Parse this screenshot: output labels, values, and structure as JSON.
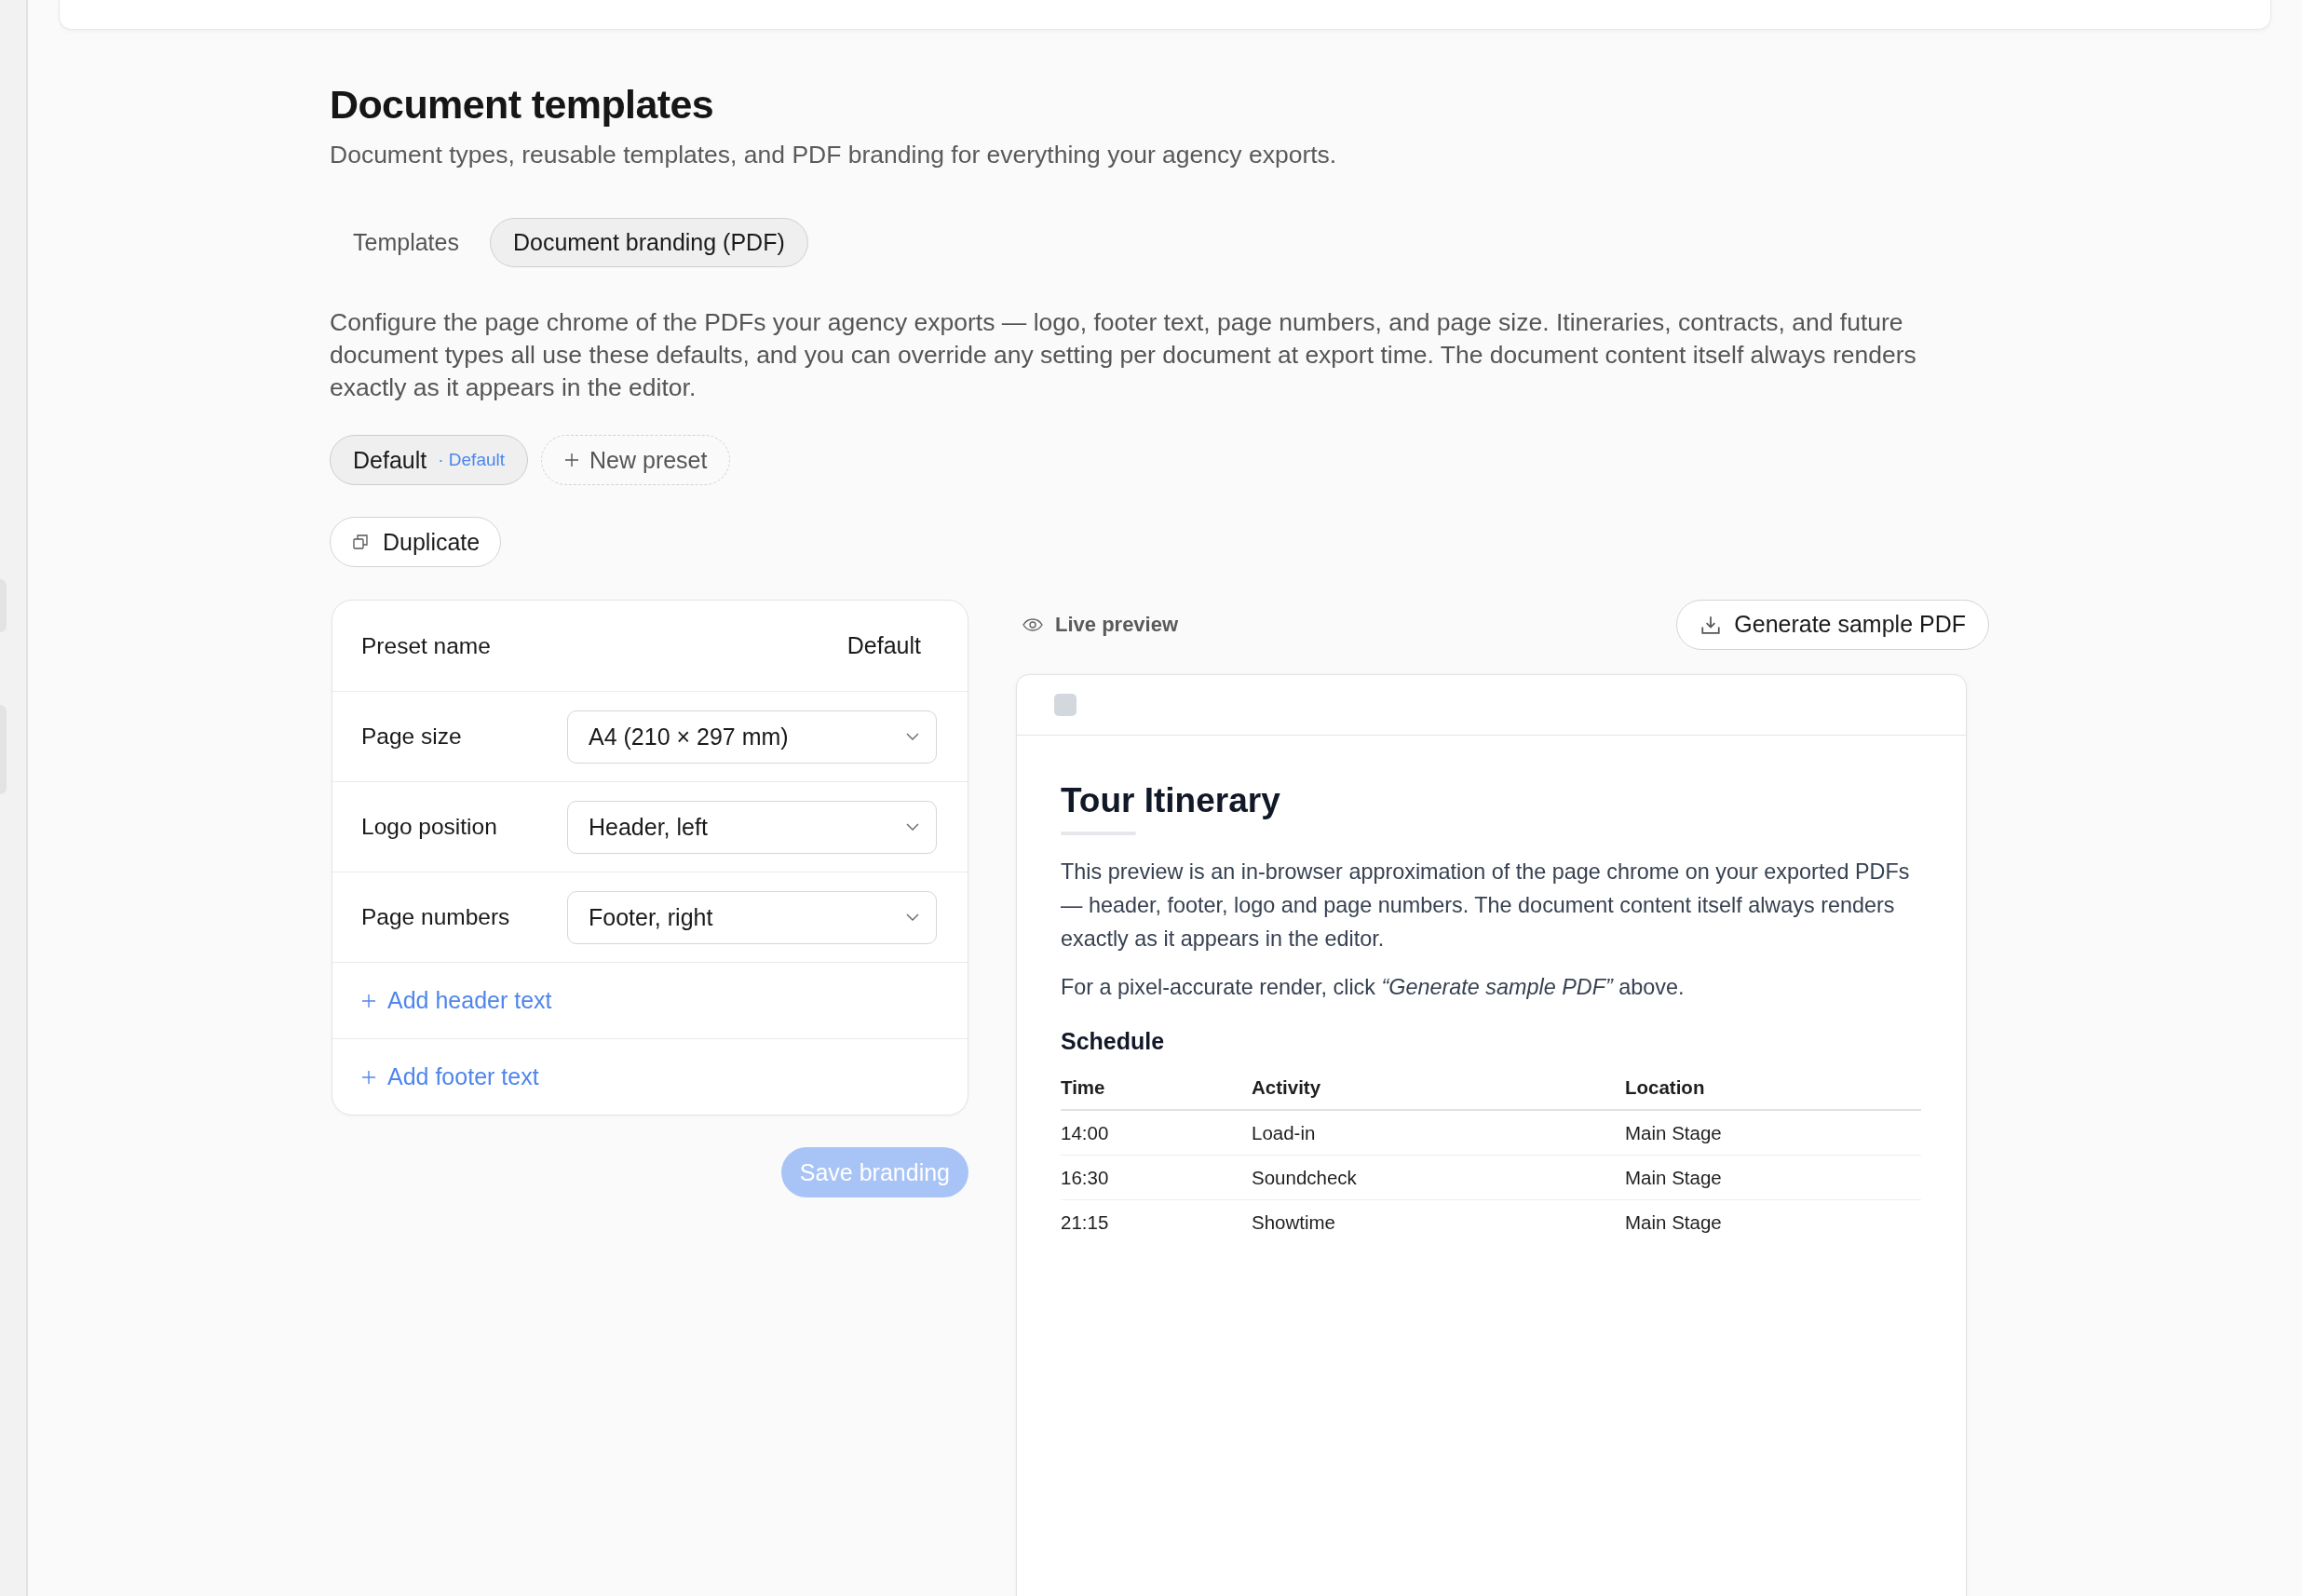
{
  "header": {
    "title": "Document templates",
    "subtitle": "Document types, reusable templates, and PDF branding for everything your agency exports."
  },
  "tabs": [
    {
      "label": "Templates",
      "selected": false
    },
    {
      "label": "Document branding (PDF)",
      "selected": true
    }
  ],
  "description": "Configure the page chrome of the PDFs your agency exports — logo, footer text, page numbers, and page size. Itineraries, contracts, and future document types all use these defaults, and you can override any setting per document at export time. The document content itself always renders exactly as it appears in the editor.",
  "presets": {
    "items": [
      {
        "name": "Default",
        "tag": "· Default",
        "selected": true
      }
    ],
    "new_label": "New preset"
  },
  "duplicate_button": "Duplicate",
  "form": {
    "rows": [
      {
        "kind": "text",
        "label": "Preset name",
        "value": "Default"
      },
      {
        "kind": "select",
        "label": "Page size",
        "value": "A4 (210 × 297 mm)"
      },
      {
        "kind": "select",
        "label": "Logo position",
        "value": "Header, left"
      },
      {
        "kind": "select",
        "label": "Page numbers",
        "value": "Footer, right"
      },
      {
        "kind": "add",
        "label": "Add header text"
      },
      {
        "kind": "add",
        "label": "Add footer text"
      }
    ]
  },
  "save_button": {
    "label": "Save branding",
    "disabled": true
  },
  "preview": {
    "label": "Live preview",
    "generate_button": "Generate sample PDF",
    "document": {
      "title": "Tour Itinerary",
      "paragraphs": [
        "This preview is an in-browser approximation of the page chrome on your exported PDFs — header, footer, logo and page numbers. The document content itself always renders exactly as it appears in the editor.",
        "For a pixel-accurate render, click *“Generate sample PDF”* above."
      ],
      "section_title": "Schedule",
      "table": {
        "columns": [
          "Time",
          "Activity",
          "Location"
        ],
        "rows": [
          [
            "14:00",
            "Load-in",
            "Main Stage"
          ],
          [
            "16:30",
            "Soundcheck",
            "Main Stage"
          ],
          [
            "21:15",
            "Showtime",
            "Main Stage"
          ]
        ]
      }
    }
  }
}
